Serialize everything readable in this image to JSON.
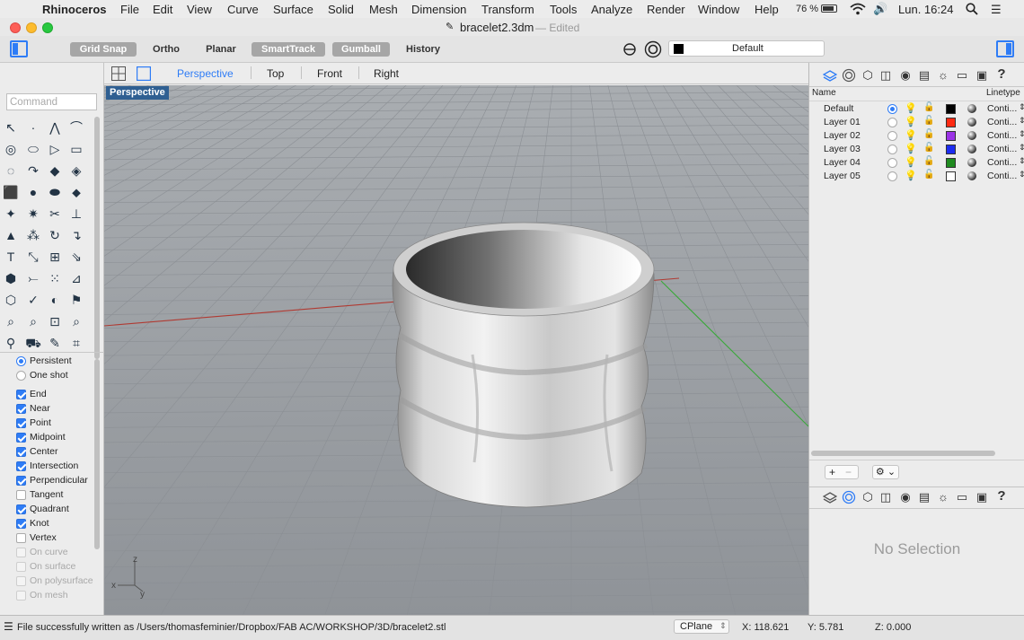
{
  "menubar": {
    "apple": "",
    "app": "Rhinoceros",
    "items": [
      "File",
      "Edit",
      "View",
      "Curve",
      "Surface",
      "Solid",
      "Mesh",
      "Dimension",
      "Transform",
      "Tools",
      "Analyze",
      "Render",
      "Window",
      "Help"
    ],
    "battery": "76 %",
    "clock": "Lun. 16:24"
  },
  "window": {
    "title": "bracelet2.3dm",
    "edited": "— Edited"
  },
  "toolbar": {
    "grid_snap": "Grid Snap",
    "ortho": "Ortho",
    "planar": "Planar",
    "smarttrack": "SmartTrack",
    "gumball": "Gumball",
    "history": "History",
    "layer": "Default"
  },
  "viewtabs": {
    "perspective": "Perspective",
    "top": "Top",
    "front": "Front",
    "right": "Right"
  },
  "viewport": {
    "label": "Perspective",
    "axis_z": "z",
    "axis_y": "y",
    "axis_x": "x"
  },
  "command": {
    "placeholder": "Command"
  },
  "osnap": {
    "persistent": "Persistent",
    "one_shot": "One shot",
    "items": [
      {
        "label": "End",
        "checked": true,
        "enabled": true
      },
      {
        "label": "Near",
        "checked": true,
        "enabled": true
      },
      {
        "label": "Point",
        "checked": true,
        "enabled": true
      },
      {
        "label": "Midpoint",
        "checked": true,
        "enabled": true
      },
      {
        "label": "Center",
        "checked": true,
        "enabled": true
      },
      {
        "label": "Intersection",
        "checked": true,
        "enabled": true
      },
      {
        "label": "Perpendicular",
        "checked": true,
        "enabled": true
      },
      {
        "label": "Tangent",
        "checked": false,
        "enabled": true
      },
      {
        "label": "Quadrant",
        "checked": true,
        "enabled": true
      },
      {
        "label": "Knot",
        "checked": true,
        "enabled": true
      },
      {
        "label": "Vertex",
        "checked": false,
        "enabled": true
      },
      {
        "label": "On curve",
        "checked": false,
        "enabled": false
      },
      {
        "label": "On surface",
        "checked": false,
        "enabled": false
      },
      {
        "label": "On polysurface",
        "checked": false,
        "enabled": false
      },
      {
        "label": "On mesh",
        "checked": false,
        "enabled": false
      }
    ]
  },
  "layers": {
    "col_name": "Name",
    "col_linetype": "Linetype",
    "rows": [
      {
        "name": "Default",
        "color": "#000000",
        "linetype": "Conti...",
        "current": true
      },
      {
        "name": "Layer 01",
        "color": "#ff2a12",
        "linetype": "Conti...",
        "current": false
      },
      {
        "name": "Layer 02",
        "color": "#9b33e6",
        "linetype": "Conti...",
        "current": false
      },
      {
        "name": "Layer 03",
        "color": "#1c2cf0",
        "linetype": "Conti...",
        "current": false
      },
      {
        "name": "Layer 04",
        "color": "#1e8a1e",
        "linetype": "Conti...",
        "current": false
      },
      {
        "name": "Layer 05",
        "color": "#ffffff",
        "linetype": "Conti...",
        "current": false
      }
    ]
  },
  "properties": {
    "empty": "No Selection"
  },
  "status": {
    "message": "File successfully written as /Users/thomasfeminier/Dropbox/FAB AC/WORKSHOP/3D/bracelet2.stl",
    "cplane": "CPlane",
    "x": "X: 118.621",
    "y": "Y: 5.781",
    "z": "Z: 0.000"
  },
  "colors": {
    "accent": "#2e7cf6",
    "viewport_bg": "#9ea2a6",
    "x_axis": "#b03a32",
    "y_axis": "#3aa83a"
  }
}
